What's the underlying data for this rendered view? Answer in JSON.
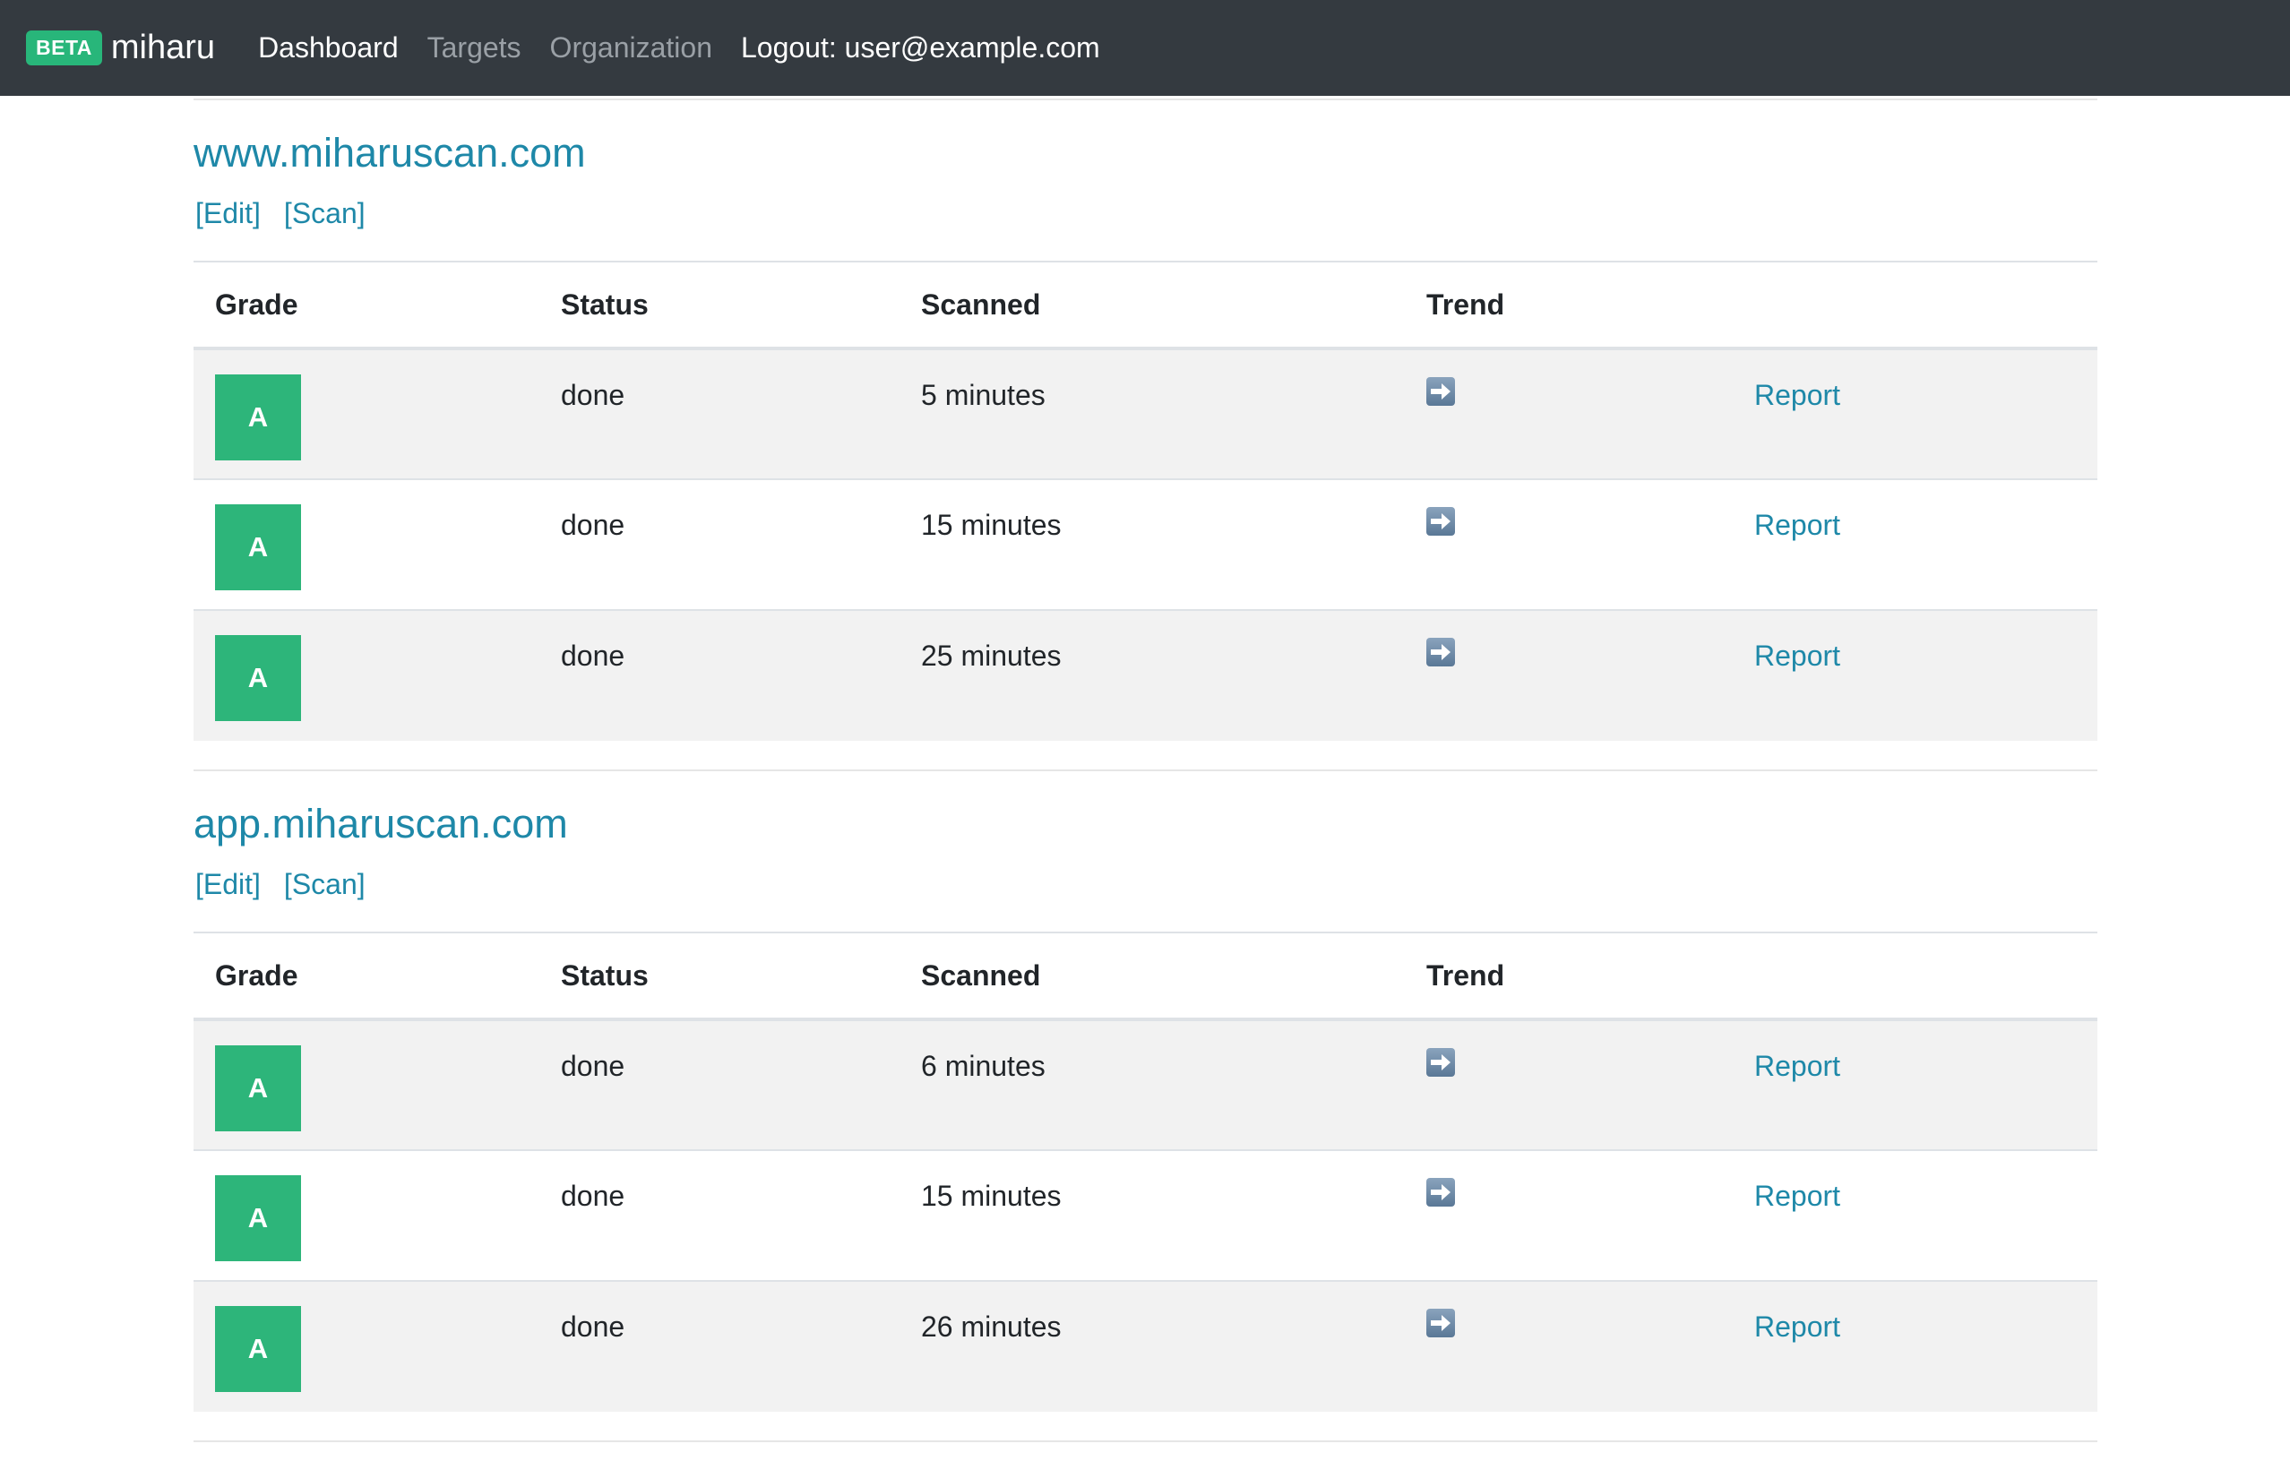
{
  "navbar": {
    "badge": "BETA",
    "brand": "miharu",
    "links": {
      "dashboard": "Dashboard",
      "targets": "Targets",
      "organization": "Organization",
      "logout": "Logout: user@example.com"
    }
  },
  "headers": {
    "grade": "Grade",
    "status": "Status",
    "scanned": "Scanned",
    "trend": "Trend"
  },
  "targets": [
    {
      "name": "www.miharuscan.com",
      "edit": "[Edit]",
      "scan": "[Scan]",
      "rows": [
        {
          "grade": "A",
          "status": "done",
          "scanned": "5 minutes",
          "trend": "arrow-right-icon",
          "report": "Report"
        },
        {
          "grade": "A",
          "status": "done",
          "scanned": "15 minutes",
          "trend": "arrow-right-icon",
          "report": "Report"
        },
        {
          "grade": "A",
          "status": "done",
          "scanned": "25 minutes",
          "trend": "arrow-right-icon",
          "report": "Report"
        }
      ]
    },
    {
      "name": "app.miharuscan.com",
      "edit": "[Edit]",
      "scan": "[Scan]",
      "rows": [
        {
          "grade": "A",
          "status": "done",
          "scanned": "6 minutes",
          "trend": "arrow-right-icon",
          "report": "Report"
        },
        {
          "grade": "A",
          "status": "done",
          "scanned": "15 minutes",
          "trend": "arrow-right-icon",
          "report": "Report"
        },
        {
          "grade": "A",
          "status": "done",
          "scanned": "26 minutes",
          "trend": "arrow-right-icon",
          "report": "Report"
        }
      ]
    }
  ],
  "colors": {
    "navbar": "#343a40",
    "grade_a": "#2db57a",
    "link": "#1e88a8",
    "badge": "#28b67a"
  }
}
